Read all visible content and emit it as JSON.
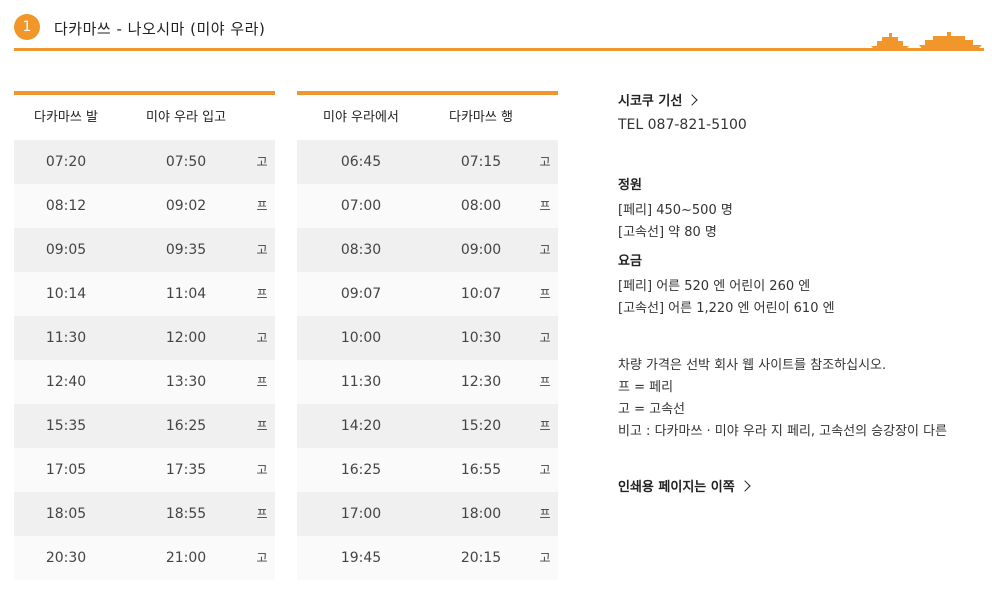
{
  "header": {
    "number": "1",
    "title": "다카마쓰 - 나오시마 (미야 우라)"
  },
  "tables": [
    {
      "headers": [
        "다카마쓰 발",
        "미야 우라 입고"
      ],
      "rows": [
        [
          "07:20",
          "07:50",
          "고"
        ],
        [
          "08:12",
          "09:02",
          "프"
        ],
        [
          "09:05",
          "09:35",
          "고"
        ],
        [
          "10:14",
          "11:04",
          "프"
        ],
        [
          "11:30",
          "12:00",
          "고"
        ],
        [
          "12:40",
          "13:30",
          "프"
        ],
        [
          "15:35",
          "16:25",
          "프"
        ],
        [
          "17:05",
          "17:35",
          "고"
        ],
        [
          "18:05",
          "18:55",
          "프"
        ],
        [
          "20:30",
          "21:00",
          "고"
        ]
      ]
    },
    {
      "headers": [
        "미야 우라에서",
        "다카마쓰 행"
      ],
      "rows": [
        [
          "06:45",
          "07:15",
          "고"
        ],
        [
          "07:00",
          "08:00",
          "프"
        ],
        [
          "08:30",
          "09:00",
          "고"
        ],
        [
          "09:07",
          "10:07",
          "프"
        ],
        [
          "10:00",
          "10:30",
          "고"
        ],
        [
          "11:30",
          "12:30",
          "프"
        ],
        [
          "14:20",
          "15:20",
          "프"
        ],
        [
          "16:25",
          "16:55",
          "고"
        ],
        [
          "17:00",
          "18:00",
          "프"
        ],
        [
          "19:45",
          "20:15",
          "고"
        ]
      ]
    }
  ],
  "info": {
    "company_link": "시코쿠 기선",
    "tel": "TEL 087-821-5100",
    "capacity_title": "정원",
    "capacity_ferry": "[페리] 450~500 명",
    "capacity_fast": "[고속선] 약 80 명",
    "fare_title": "요금",
    "fare_ferry": "[페리] 어른 520 엔 어린이 260 엔",
    "fare_fast": "[고속선] 어른 1,220 엔 어린이 610 엔",
    "note_vehicle": "차량 가격은 선박 회사 웹 사이트를 참조하십시오.",
    "legend_ferry": "프 = 페리",
    "legend_fast": "고 = 고속선",
    "remark": "비고 : 다카마쓰 · 미야 우라 지 페리, 고속선의 승강장이 다른",
    "print_link": "인쇄용 페이지는 이쪽"
  },
  "colors": {
    "accent": "#f0962b"
  }
}
